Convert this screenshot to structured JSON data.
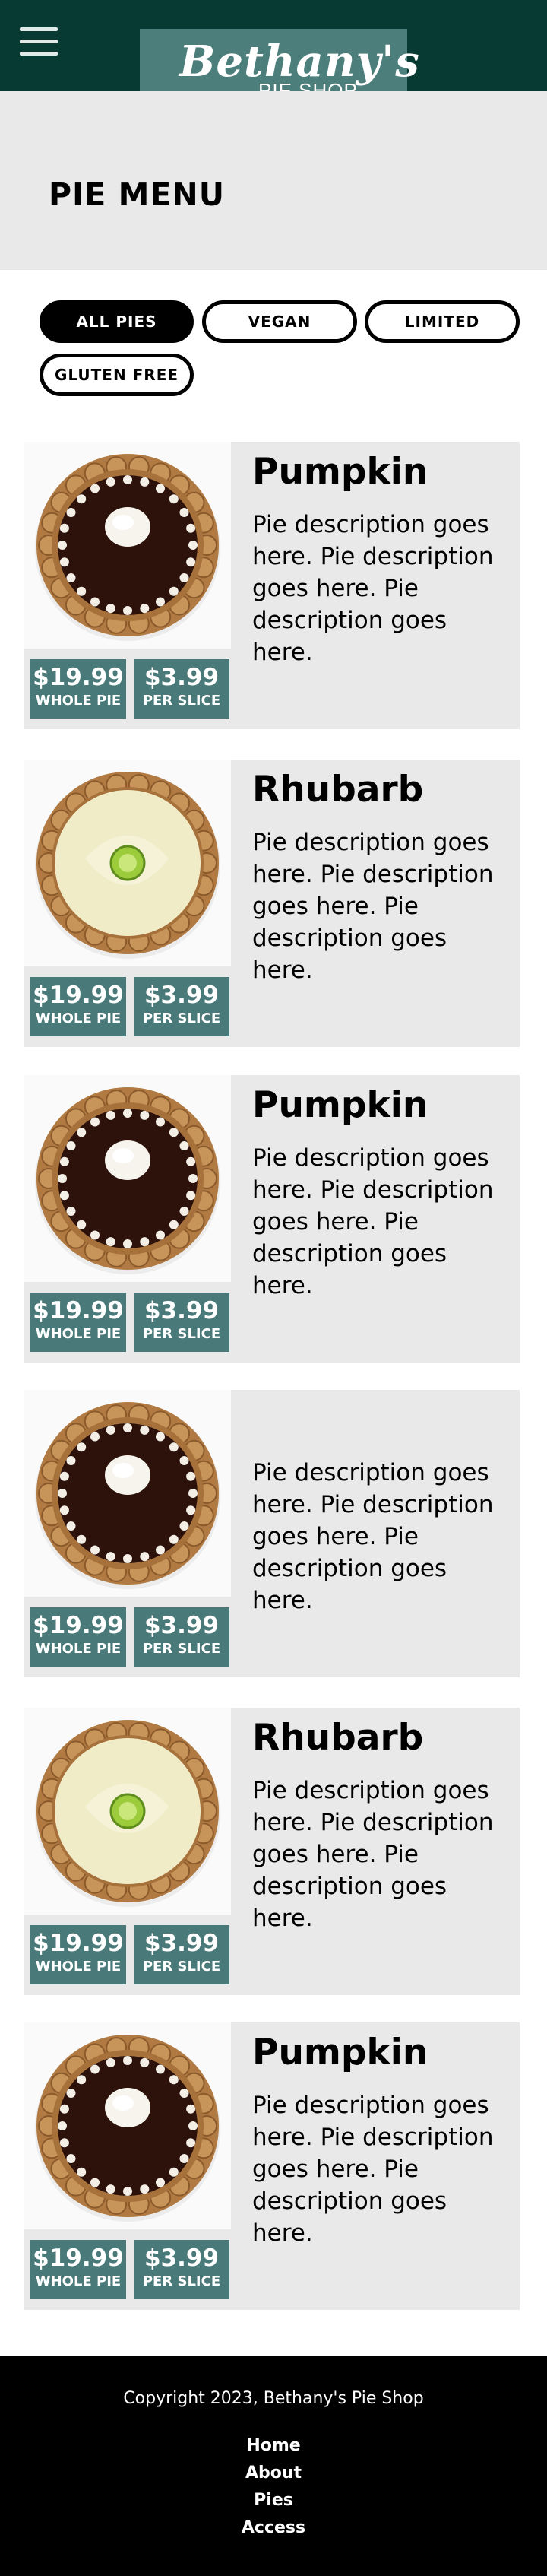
{
  "header": {
    "menu_icon": "hamburger-menu-icon",
    "logo_script": "Bethany's",
    "logo_sub": "PIE SHOP"
  },
  "page": {
    "title": "PIE MENU"
  },
  "filters": [
    "ALL PIES",
    "VEGAN",
    "LIMITED",
    "GLUTEN FREE"
  ],
  "pies": [
    {
      "name": "Pumpkin",
      "image": "chocolate-pie-image",
      "description": "Pie description goes here. Pie description goes here. Pie description goes here.",
      "whole_price": "$19.99",
      "whole_label": "WHOLE PIE",
      "slice_price": "$3.99",
      "slice_label": "PER SLICE"
    },
    {
      "name": "Rhubarb",
      "image": "key-lime-pie-image",
      "description": "Pie description goes here. Pie description goes here. Pie description goes here.",
      "whole_price": "$19.99",
      "whole_label": "WHOLE PIE",
      "slice_price": "$3.99",
      "slice_label": "PER SLICE"
    },
    {
      "name": "Pumpkin",
      "image": "chocolate-pie-image",
      "description": "Pie description goes here. Pie description goes here. Pie description goes here.",
      "whole_price": "$19.99",
      "whole_label": "WHOLE PIE",
      "slice_price": "$3.99",
      "slice_label": "PER SLICE"
    },
    {
      "name": "",
      "image": "chocolate-pie-image",
      "description": "Pie description goes here. Pie description goes here. Pie description goes here.",
      "whole_price": "$19.99",
      "whole_label": "WHOLE PIE",
      "slice_price": "$3.99",
      "slice_label": "PER SLICE"
    },
    {
      "name": "Rhubarb",
      "image": "key-lime-pie-image",
      "description": "Pie description goes here. Pie description goes here. Pie description goes here.",
      "whole_price": "$19.99",
      "whole_label": "WHOLE PIE",
      "slice_price": "$3.99",
      "slice_label": "PER SLICE"
    },
    {
      "name": "Pumpkin",
      "image": "chocolate-pie-image",
      "description": "Pie description goes here. Pie description goes here. Pie description goes here.",
      "whole_price": "$19.99",
      "whole_label": "WHOLE PIE",
      "slice_price": "$3.99",
      "slice_label": "PER SLICE"
    }
  ],
  "footer": {
    "copyright": "Copyright 2023, Bethany's Pie Shop",
    "links": [
      "Home",
      "About",
      "Pies",
      "Access"
    ]
  },
  "colors": {
    "header_bg": "#063a32",
    "logo_bg": "#4c7f7c",
    "price_bg": "#497a79",
    "panel_bg": "#e9e9e9",
    "footer_bg": "#000000"
  }
}
